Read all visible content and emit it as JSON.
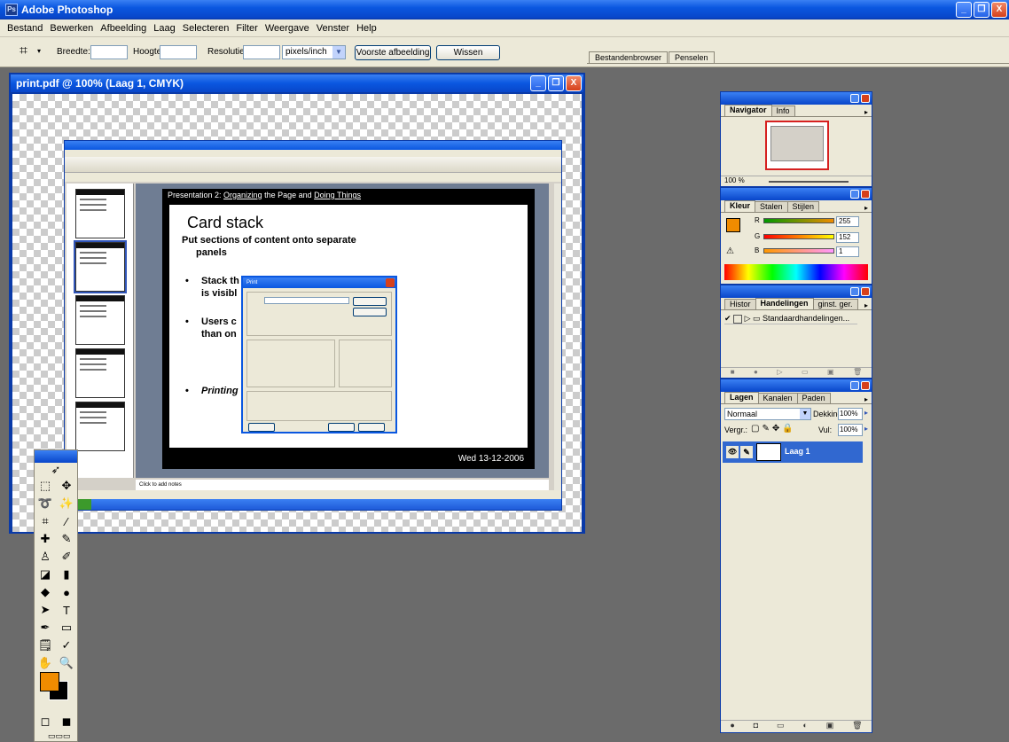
{
  "app": {
    "title": "Adobe Photoshop",
    "logo": "Ps"
  },
  "window_buttons": {
    "min": "_",
    "restore": "❐",
    "close": "X"
  },
  "menu": [
    "Bestand",
    "Bewerken",
    "Afbeelding",
    "Laag",
    "Selecteren",
    "Filter",
    "Weergave",
    "Venster",
    "Help"
  ],
  "options": {
    "width_label": "Breedte:",
    "height_label": "Hoogte:",
    "resolution_label": "Resolutie:",
    "unit_value": "pixels/inch",
    "front_image_btn": "Voorste afbeelding",
    "clear_btn": "Wissen"
  },
  "well_tabs": [
    "Bestandenbrowser",
    "Penselen"
  ],
  "document": {
    "title": "print.pdf @ 100% (Laag 1, CMYK)",
    "slide": {
      "header_prefix": "Presentation 2: ",
      "header_link1": "Organizing",
      "header_mid": " the Page and ",
      "header_link2": "Doing Things",
      "title": "Card stack",
      "line1": "Put sections of content onto separate",
      "line2": "panels",
      "bullet1a": "Stack th",
      "bullet1b": "is visibl",
      "bullet2a": "Users c",
      "bullet2b": "than on",
      "bullet3": "Printing",
      "footer": "Wed 13-12-2006",
      "bullet_char": "•"
    },
    "notes": "Click to add notes",
    "dialog_title": "Print"
  },
  "navigator": {
    "tabs": [
      "Navigator",
      "Info"
    ],
    "zoom": "100 %"
  },
  "color_panel": {
    "tabs": [
      "Kleur",
      "Stalen",
      "Stijlen"
    ],
    "r_label": "R",
    "g_label": "G",
    "b_label": "B",
    "r": "255",
    "g": "152",
    "b": "1",
    "fg": "#f08c00"
  },
  "actions_panel": {
    "tabs": [
      "Histor",
      "Handelingen",
      "ginst. ger."
    ],
    "set_name": "Standaardhandelingen..."
  },
  "layers_panel": {
    "tabs": [
      "Lagen",
      "Kanalen",
      "Paden"
    ],
    "blend_mode": "Normaal",
    "opacity_label": "Dekking:",
    "opacity": "100%",
    "lock_label": "Vergr.:",
    "fill_label": "Vul:",
    "fill": "100%",
    "layer_name": "Laag 1"
  },
  "icons": {
    "crop": "⌗",
    "eye": "👁",
    "brush": "✎",
    "folder": "▭",
    "play": "▷",
    "stop": "■",
    "record": "●",
    "trash": "🗑",
    "new": "▣",
    "check": "✔"
  }
}
